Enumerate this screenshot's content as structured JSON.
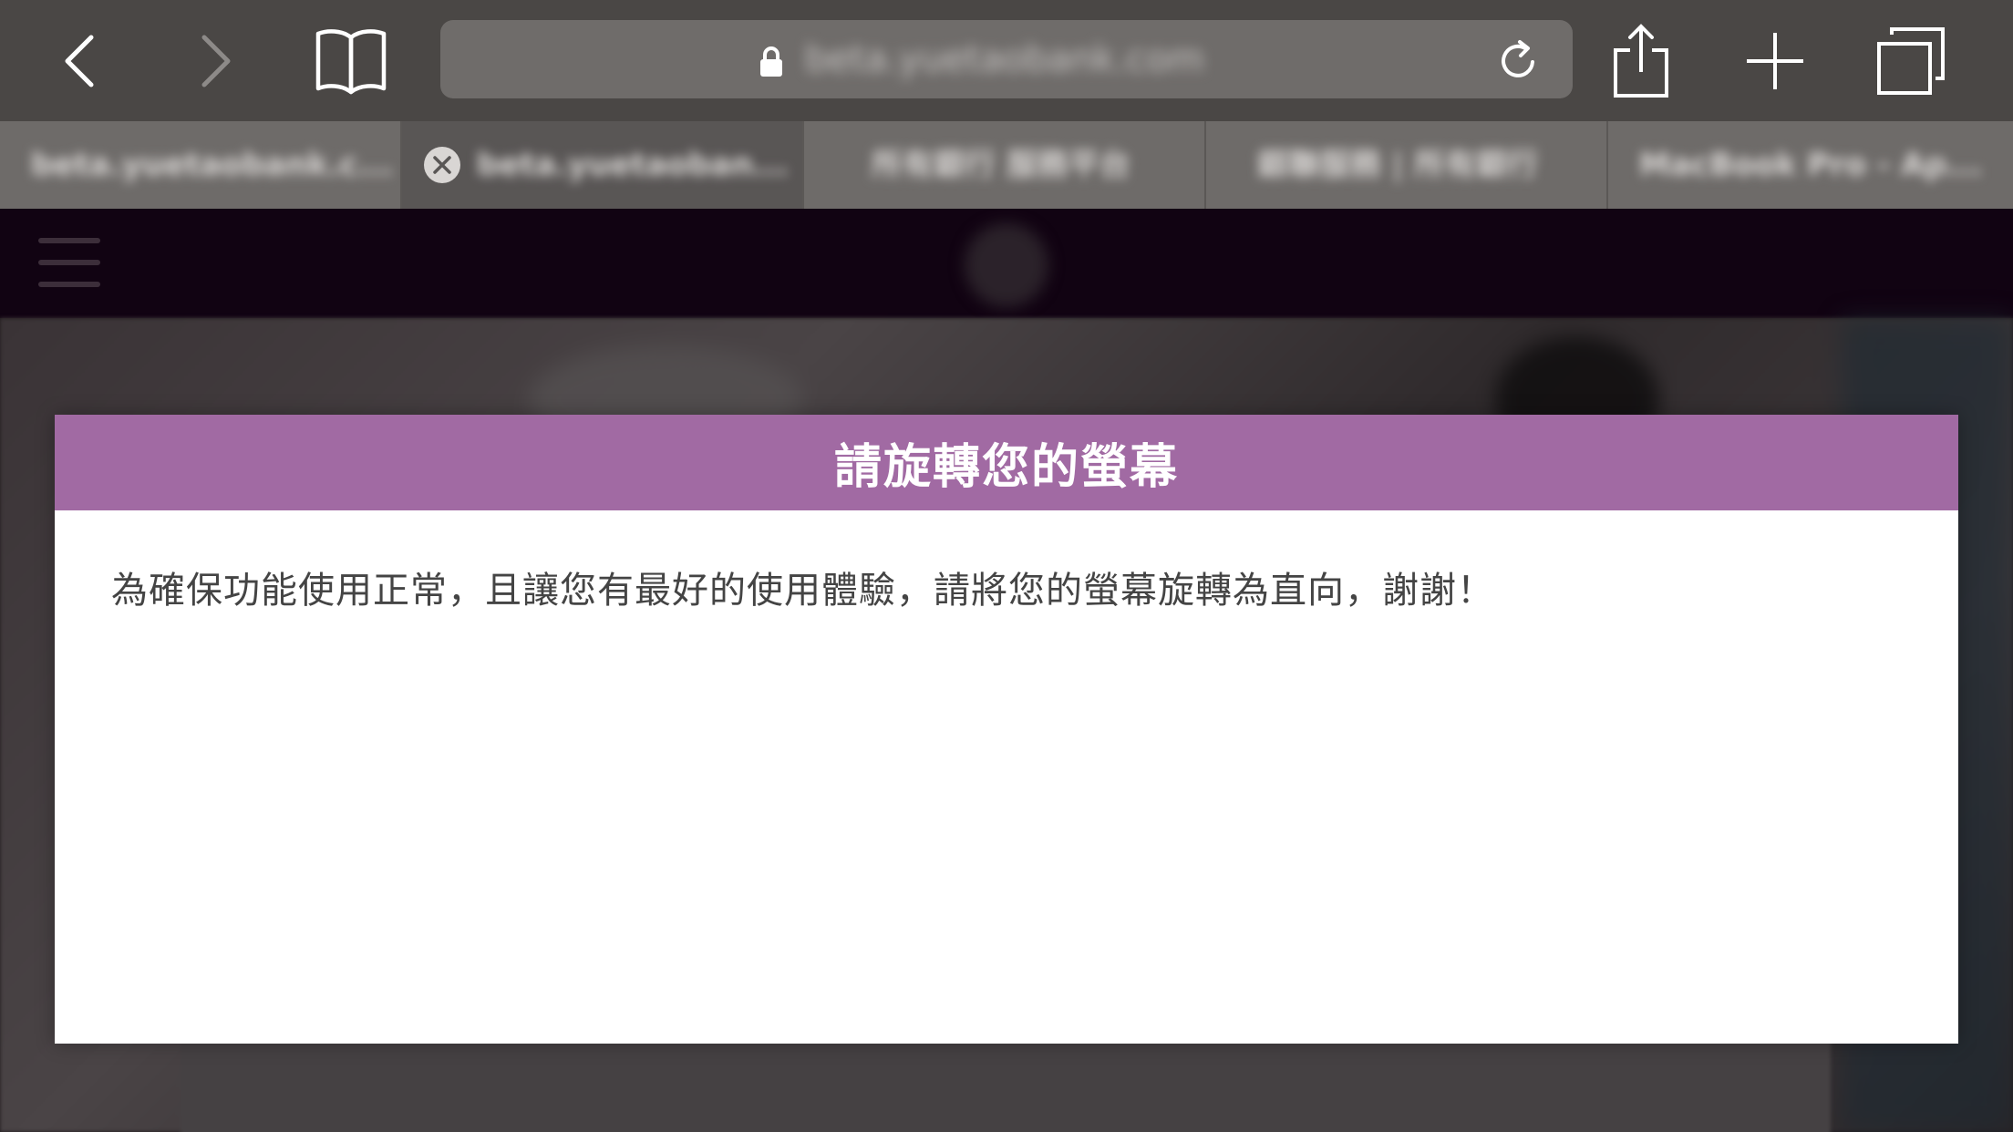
{
  "browser": {
    "address_bar": {
      "url": "beta.yuetaobank.com"
    },
    "tabs": [
      {
        "title": "beta.yuetaobank.c..."
      },
      {
        "title": "beta.yuetaoban..."
      },
      {
        "title": "所有銀行 服務平台"
      },
      {
        "title": "銀聯服務 | 所有銀行"
      },
      {
        "title": "MacBook Pro - Ap..."
      }
    ],
    "active_tab_index": 1
  },
  "modal": {
    "title": "請旋轉您的螢幕",
    "message": "為確保功能使用正常，且讓您有最好的使用體驗，請將您的螢幕旋轉為直向，謝謝！",
    "header_color": "#a16aa3"
  },
  "site_nav": {
    "background_color": "#110312"
  }
}
